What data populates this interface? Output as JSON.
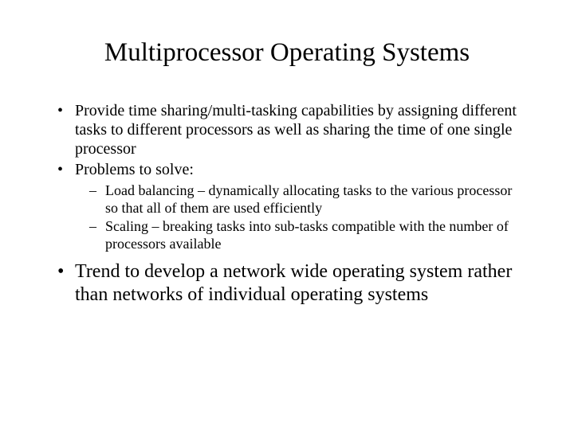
{
  "title": "Multiprocessor Operating Systems",
  "bullets": {
    "b1": "Provide time sharing/multi-tasking capabilities by assigning different tasks to different processors as well as sharing the time of one single processor",
    "b2": "Problems to solve:",
    "b2_sub": {
      "s1": "Load balancing – dynamically allocating tasks to the various processor so that all of them are used efficiently",
      "s2": "Scaling – breaking tasks into sub-tasks compatible with the number of processors available"
    },
    "b3": "Trend to develop a network wide operating system rather than networks of individual operating systems"
  }
}
